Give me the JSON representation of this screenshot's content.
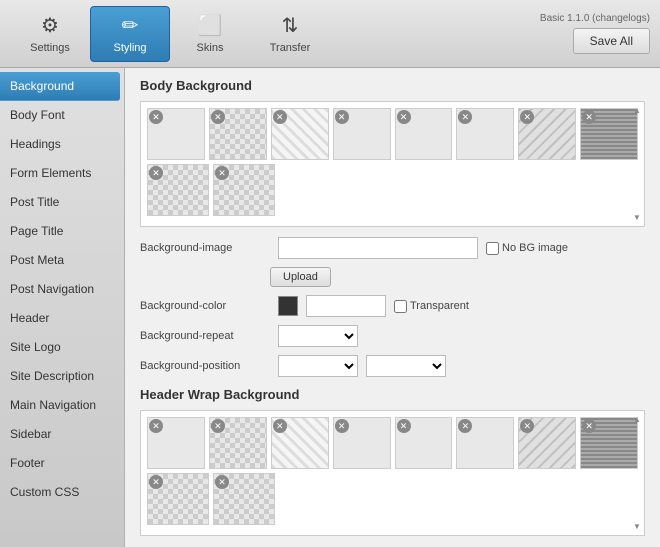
{
  "app": {
    "version": "Basic 1.1.0 (changelogs)"
  },
  "toolbar": {
    "items": [
      {
        "id": "settings",
        "label": "Settings",
        "icon": "⚙"
      },
      {
        "id": "styling",
        "label": "Styling",
        "icon": "✏",
        "active": true
      },
      {
        "id": "skins",
        "label": "Skins",
        "icon": "◻"
      },
      {
        "id": "transfer",
        "label": "Transfer",
        "icon": "↕"
      }
    ],
    "save_label": "Save All"
  },
  "sidebar": {
    "items": [
      {
        "id": "background",
        "label": "Background",
        "active": true
      },
      {
        "id": "body-font",
        "label": "Body Font"
      },
      {
        "id": "headings",
        "label": "Headings"
      },
      {
        "id": "form-elements",
        "label": "Form Elements"
      },
      {
        "id": "post-title",
        "label": "Post Title"
      },
      {
        "id": "page-title",
        "label": "Page Title"
      },
      {
        "id": "post-meta",
        "label": "Post Meta"
      },
      {
        "id": "post-navigation",
        "label": "Post Navigation"
      },
      {
        "id": "header",
        "label": "Header"
      },
      {
        "id": "site-logo",
        "label": "Site Logo"
      },
      {
        "id": "site-description",
        "label": "Site Description"
      },
      {
        "id": "main-navigation",
        "label": "Main Navigation"
      },
      {
        "id": "sidebar",
        "label": "Sidebar"
      },
      {
        "id": "footer",
        "label": "Footer"
      },
      {
        "id": "custom-css",
        "label": "Custom CSS"
      }
    ]
  },
  "main": {
    "body_background": {
      "title": "Body Background",
      "patterns": [
        {
          "row": 0,
          "col": 0,
          "type": "solid-light"
        },
        {
          "row": 0,
          "col": 1,
          "type": "checkered"
        },
        {
          "row": 0,
          "col": 2,
          "type": "striped"
        },
        {
          "row": 0,
          "col": 3,
          "type": "solid-light"
        },
        {
          "row": 0,
          "col": 4,
          "type": "solid-light"
        },
        {
          "row": 0,
          "col": 5,
          "type": "solid-light"
        },
        {
          "row": 0,
          "col": 6,
          "type": "diagonal-stripes"
        },
        {
          "row": 0,
          "col": 7,
          "type": "dark-pattern"
        },
        {
          "row": 1,
          "col": 0,
          "type": "checkered"
        },
        {
          "row": 1,
          "col": 1,
          "type": "checkered"
        }
      ]
    },
    "bg_image_label": "Background-image",
    "bg_image_placeholder": "",
    "no_bg_image_label": "No BG image",
    "upload_label": "Upload",
    "bg_color_label": "Background-color",
    "transparent_label": "Transparent",
    "bg_repeat_label": "Background-repeat",
    "bg_position_label": "Background-position",
    "header_wrap": {
      "title": "Header Wrap Background"
    }
  }
}
